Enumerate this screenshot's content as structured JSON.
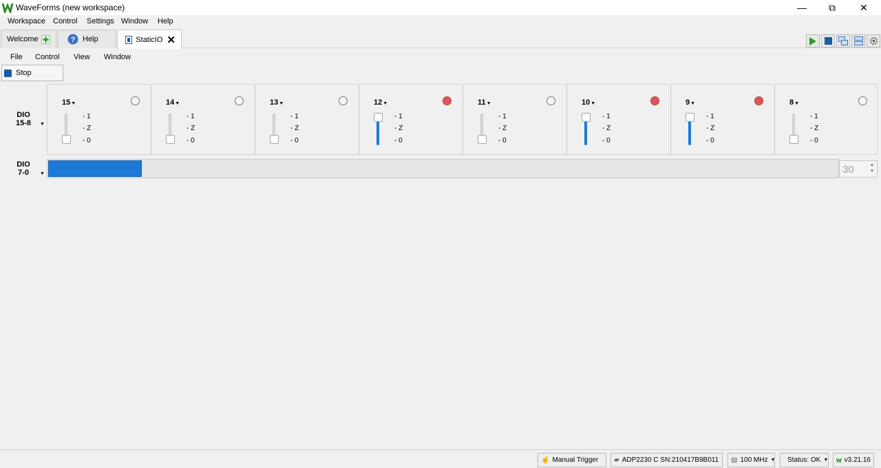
{
  "window": {
    "title": "WaveForms (new workspace)",
    "minimize": "—",
    "restore": "⧉",
    "close": "✕"
  },
  "menubar": [
    "Workspace",
    "Control",
    "Settings",
    "Window",
    "Help"
  ],
  "tabs": [
    {
      "label": "Welcome",
      "icon": "plus-icon"
    },
    {
      "label": "Help",
      "icon": "help-icon"
    },
    {
      "label": "StaticIO",
      "icon": "staticio-icon",
      "close": "✕",
      "active": true
    }
  ],
  "inner_menu": [
    "File",
    "Control",
    "View",
    "Window"
  ],
  "stop_button": {
    "label": "Stop"
  },
  "groups": [
    {
      "name_line1": "DIO",
      "name_line2": "15-8"
    },
    {
      "name_line1": "DIO",
      "name_line2": "7-0"
    }
  ],
  "levels": [
    "- 1",
    "- Z",
    "- 0"
  ],
  "pins": [
    {
      "num": "15",
      "led_on": false,
      "value": "0"
    },
    {
      "num": "14",
      "led_on": false,
      "value": "0"
    },
    {
      "num": "13",
      "led_on": false,
      "value": "0"
    },
    {
      "num": "12",
      "led_on": true,
      "value": "1"
    },
    {
      "num": "11",
      "led_on": false,
      "value": "0"
    },
    {
      "num": "10",
      "led_on": true,
      "value": "1"
    },
    {
      "num": "9",
      "led_on": true,
      "value": "1"
    },
    {
      "num": "8",
      "led_on": false,
      "value": "0"
    }
  ],
  "bar": {
    "value": "30",
    "fill_fraction": 0.118
  },
  "colors": {
    "accent": "#1a7ad6",
    "led_on": "#e05656",
    "stop": "#1b5d9e",
    "logo": "#2e8b2e"
  },
  "status": {
    "manual_trigger": "Manual Trigger",
    "device": "ADP2230 C SN:210417B9B011",
    "clock": "100 MHz",
    "status": "Status: OK",
    "version": "v3.21.16"
  }
}
